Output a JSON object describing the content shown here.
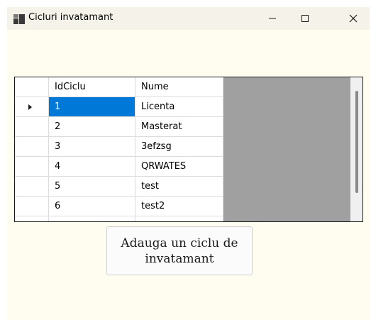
{
  "window": {
    "title": "Cicluri invatamant",
    "minimize_icon": "minimize-icon",
    "maximize_icon": "maximize-icon",
    "close_icon": "close-icon"
  },
  "grid": {
    "columns": [
      "IdCiclu",
      "Nume"
    ],
    "rows": [
      {
        "id": "1",
        "name": "Licenta",
        "selected": true
      },
      {
        "id": "2",
        "name": "Masterat"
      },
      {
        "id": "3",
        "name": "3efzsg"
      },
      {
        "id": "4",
        "name": "QRWATES"
      },
      {
        "id": "5",
        "name": "test"
      },
      {
        "id": "6",
        "name": "test2"
      }
    ],
    "current_row_icon": "triangle-right-icon",
    "selection_color": "#0078d7"
  },
  "actions": {
    "add_label": "Adauga un ciclu de invatamant"
  }
}
